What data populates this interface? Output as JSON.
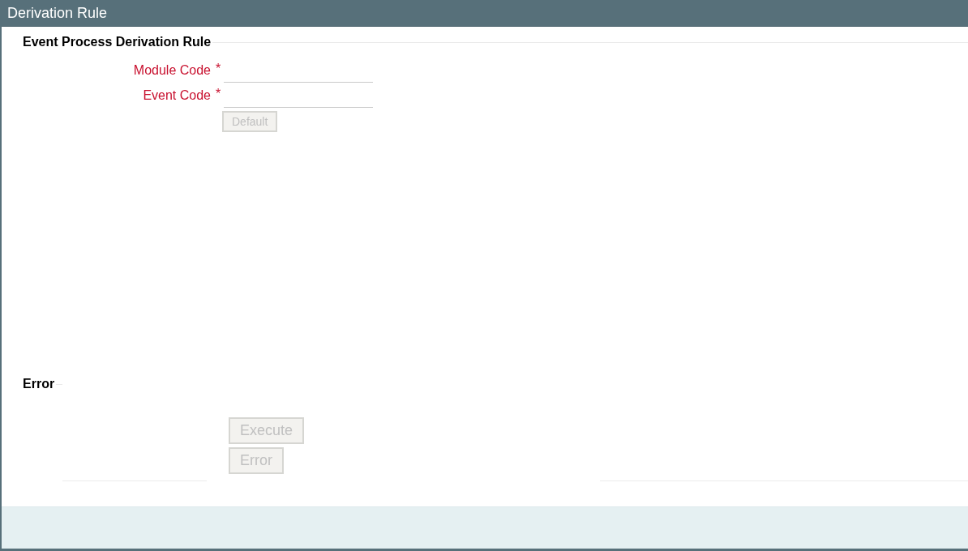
{
  "window": {
    "title": "Derivation Rule"
  },
  "sections": [
    {
      "title": "Event Process Derivation Rule",
      "fields": [
        {
          "label": "Module Code",
          "marker": "*"
        },
        {
          "label": "Event Code",
          "marker": "*"
        }
      ],
      "buttons": [
        {
          "label": "Default",
          "disabled": true
        }
      ]
    },
    {
      "title": "Error",
      "buttons": [
        {
          "label": "Execute",
          "disabled": true
        },
        {
          "label": "Error",
          "disabled": true
        }
      ]
    }
  ]
}
